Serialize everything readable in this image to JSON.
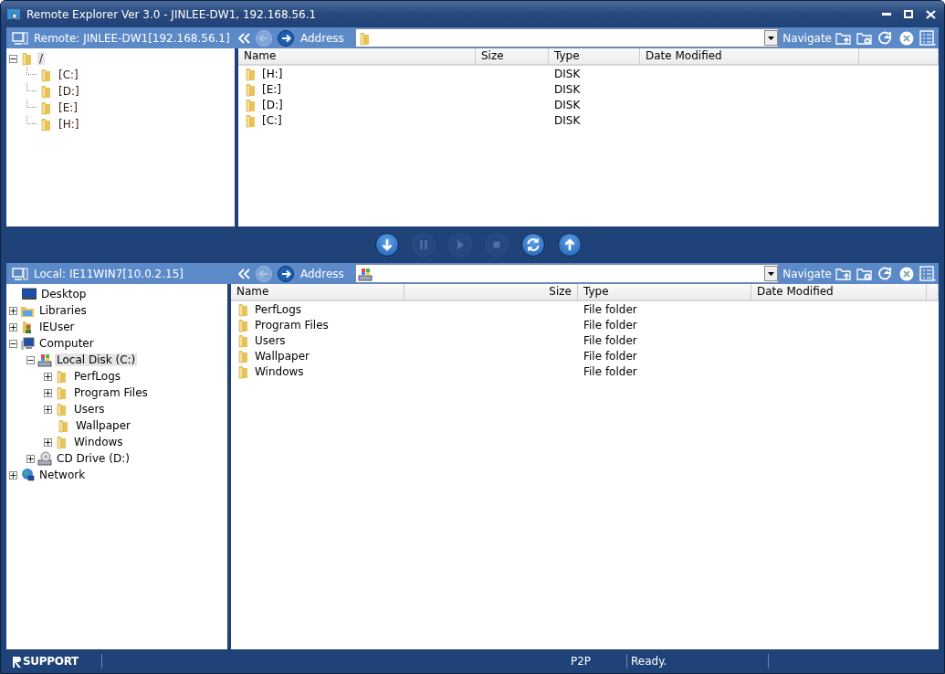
{
  "window": {
    "title": "Remote Explorer Ver 3.0 - JINLEE-DW1, 192.168.56.1"
  },
  "panes": [
    {
      "kind": "remote",
      "label": "Remote: JINLEE-DW1[192.168.56.1]",
      "address_label": "Address",
      "navigate_label": "Navigate",
      "back_disabled": true,
      "forward_disabled": false,
      "tree": [
        {
          "label": "/",
          "kind": "folder",
          "selected": true,
          "expandable": true,
          "expanded": true,
          "children": [
            {
              "label": "[C:]",
              "kind": "folder",
              "selected": false,
              "expandable": false
            },
            {
              "label": "[D:]",
              "kind": "folder",
              "selected": false,
              "expandable": false
            },
            {
              "label": "[E:]",
              "kind": "folder",
              "selected": false,
              "expandable": false
            },
            {
              "label": "[H:]",
              "kind": "folder",
              "selected": false,
              "expandable": false
            }
          ]
        }
      ],
      "columns": [
        "Name",
        "Size",
        "Type",
        "Date Modified"
      ],
      "rows": [
        {
          "name": "[H:]",
          "type": "DISK"
        },
        {
          "name": "[E:]",
          "type": "DISK"
        },
        {
          "name": "[D:]",
          "type": "DISK"
        },
        {
          "name": "[C:]",
          "type": "DISK"
        }
      ]
    },
    {
      "kind": "local",
      "label": "Local: IE11WIN7[10.0.2.15]",
      "address_label": "Address",
      "navigate_label": "Navigate",
      "back_disabled": true,
      "forward_disabled": false,
      "tree": [
        {
          "label": "Desktop",
          "kind": "desktop",
          "selected": false,
          "expandable": false
        },
        {
          "label": "Libraries",
          "kind": "libraries",
          "selected": false,
          "expandable": true,
          "expanded": false
        },
        {
          "label": "IEUser",
          "kind": "user",
          "selected": false,
          "expandable": true,
          "expanded": false
        },
        {
          "label": "Computer",
          "kind": "computer",
          "selected": false,
          "expandable": true,
          "expanded": true,
          "children": [
            {
              "label": "Local Disk (C:)",
              "kind": "drive",
              "selected": true,
              "expandable": true,
              "expanded": true,
              "children": [
                {
                  "label": "PerfLogs",
                  "kind": "folder",
                  "selected": false,
                  "expandable": true,
                  "expanded": false
                },
                {
                  "label": "Program Files",
                  "kind": "folder",
                  "selected": false,
                  "expandable": true,
                  "expanded": false
                },
                {
                  "label": "Users",
                  "kind": "folder",
                  "selected": false,
                  "expandable": true,
                  "expanded": false
                },
                {
                  "label": "Wallpaper",
                  "kind": "folder",
                  "selected": false,
                  "expandable": false
                },
                {
                  "label": "Windows",
                  "kind": "folder",
                  "selected": false,
                  "expandable": true,
                  "expanded": false
                }
              ]
            },
            {
              "label": "CD Drive (D:)",
              "kind": "cdrom",
              "selected": false,
              "expandable": true,
              "expanded": false
            }
          ]
        },
        {
          "label": "Network",
          "kind": "network",
          "selected": false,
          "expandable": true,
          "expanded": false
        }
      ],
      "columns": [
        "Name",
        "Size",
        "Type",
        "Date Modified"
      ],
      "rows": [
        {
          "name": "PerfLogs",
          "type": "File folder"
        },
        {
          "name": "Program Files",
          "type": "File folder"
        },
        {
          "name": "Users",
          "type": "File folder"
        },
        {
          "name": "Wallpaper",
          "type": "File folder"
        },
        {
          "name": "Windows",
          "type": "File folder"
        }
      ]
    }
  ],
  "transfer_buttons": [
    {
      "kind": "download",
      "disabled": false
    },
    {
      "kind": "pause",
      "disabled": true
    },
    {
      "kind": "play",
      "disabled": true
    },
    {
      "kind": "stop",
      "disabled": true
    },
    {
      "kind": "sync",
      "disabled": false
    },
    {
      "kind": "upload",
      "disabled": false
    }
  ],
  "status_bar": {
    "logo": "SUPPORT",
    "mode": "P2P",
    "status": "Ready."
  }
}
